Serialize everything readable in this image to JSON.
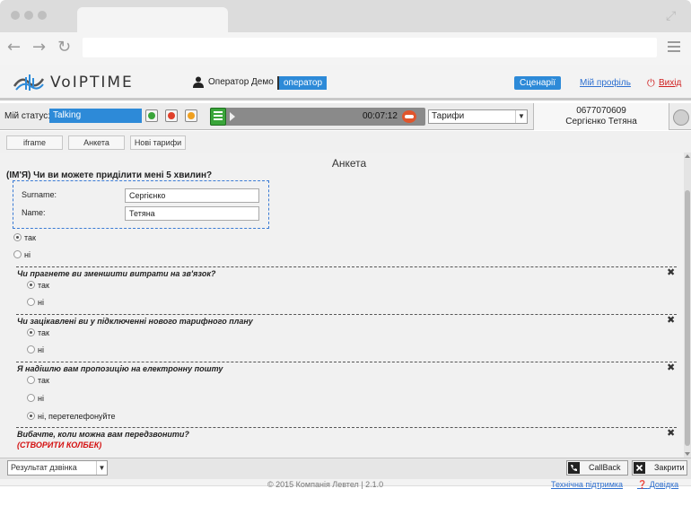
{
  "app": {
    "logo_text": "VoIPTIME",
    "operator_name": "Оператор Демо",
    "role": "оператор",
    "scenarios_label": "Сценарії",
    "profile_label": "Мій профіль",
    "exit_label": "Вихід"
  },
  "statusbar": {
    "my_status_label": "Мій статус:",
    "status_value": "Talking",
    "call_timer": "00:07:12",
    "tariff_select": "Тарифи",
    "caller_phone": "0677070609",
    "caller_name": "Сергієнко Тетяна"
  },
  "tabs": [
    {
      "label": "iframe"
    },
    {
      "label": "Анкета"
    },
    {
      "label": "Нові тарифи"
    }
  ],
  "form": {
    "title": "Анкета",
    "main_question": "(ІМ'Я) Чи ви можете приділити мені 5 хвилин?",
    "fields": [
      {
        "label": "Surname:",
        "value": "Сергієнко"
      },
      {
        "label": "Name:",
        "value": "Тетяна"
      }
    ],
    "main_options": [
      {
        "label": "так",
        "checked": true
      },
      {
        "label": "ні",
        "checked": false
      }
    ],
    "sub_questions": [
      {
        "text": "Чи прагнете ви зменшити витрати на зв'язок?",
        "options": [
          {
            "label": "так",
            "checked": true
          },
          {
            "label": "ні",
            "checked": false
          }
        ]
      },
      {
        "text": "Чи зацікавлені ви у підключенні нового тарифного плану",
        "options": [
          {
            "label": "так",
            "checked": true
          },
          {
            "label": "ні",
            "checked": false
          }
        ]
      },
      {
        "text": "Я надішлю вам пропозицію на електронну пошту",
        "options": [
          {
            "label": "так",
            "checked": false
          },
          {
            "label": "ні",
            "checked": false
          },
          {
            "label": "ні, перетелефонуйте",
            "checked": true
          }
        ]
      },
      {
        "text": "Вибачте, коли можна вам передзвонити?",
        "action": "(СТВОРИТИ КОЛБЕК)"
      }
    ]
  },
  "footer": {
    "result_placeholder": "Результат дзвінка",
    "callback_label": "CallBack",
    "close_label": "Закрити",
    "copyright": "© 2015 Компанія Левтел | 2.1.0",
    "support_label": "Технічна підтримка",
    "help_label": "Довідка"
  },
  "colors": {
    "accent": "#2d8ad8",
    "danger": "#d41010"
  }
}
